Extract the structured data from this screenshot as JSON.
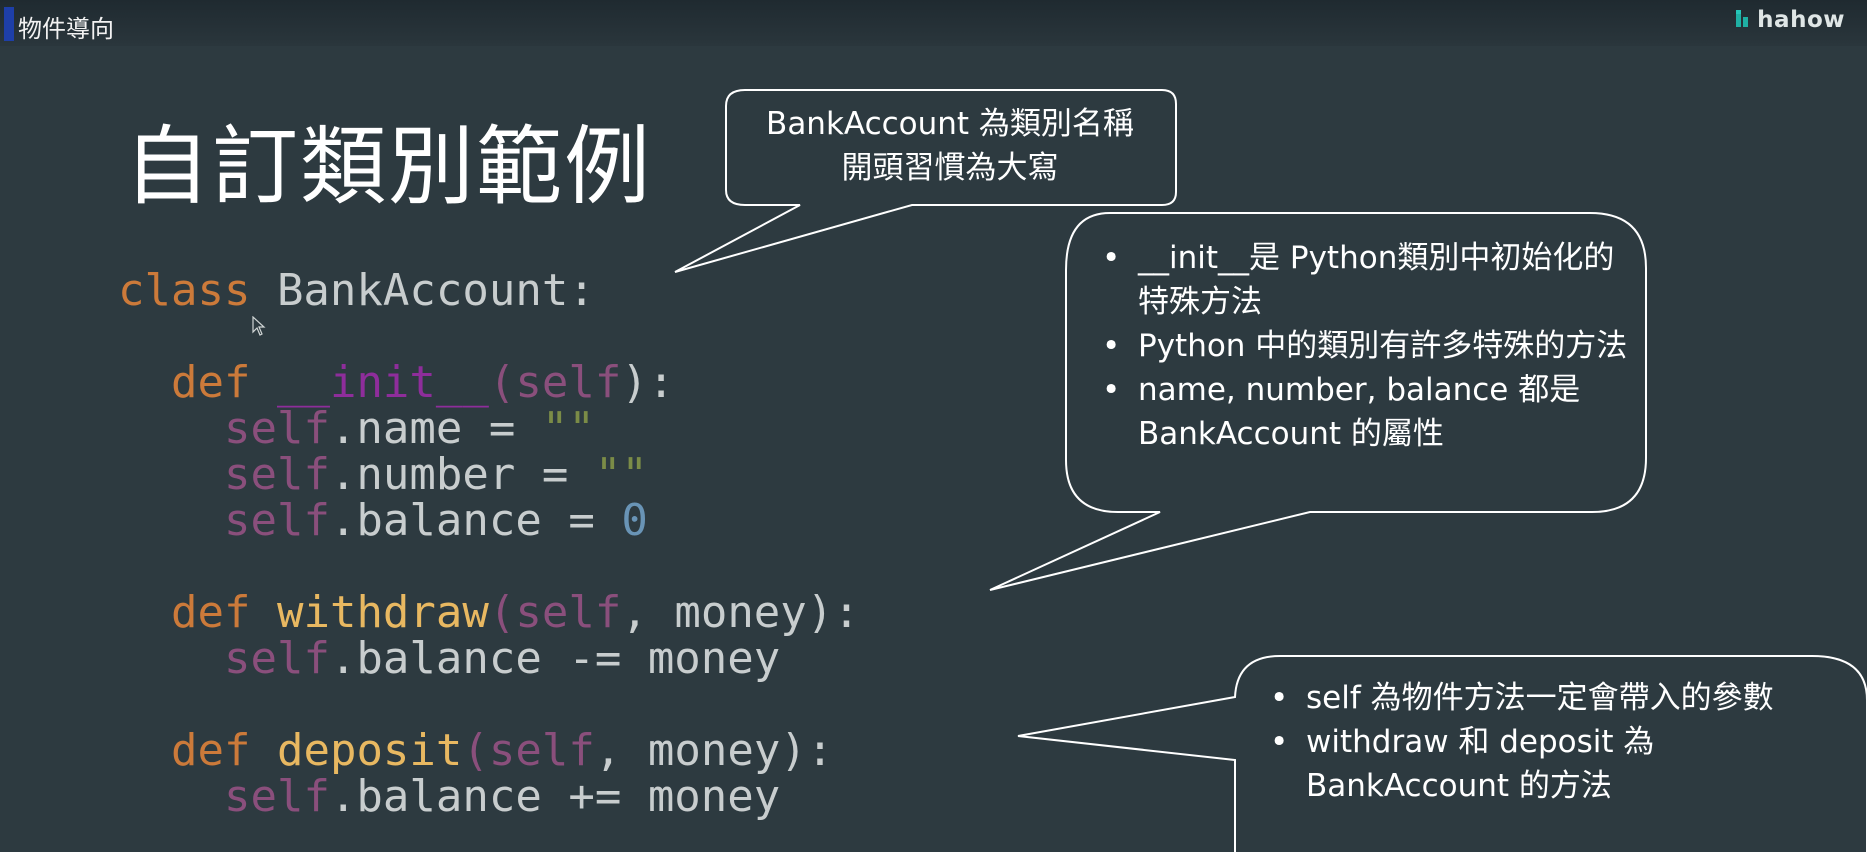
{
  "header": {
    "title": "物件導向",
    "brand": "hahow"
  },
  "slide": {
    "title": "自訂類別範例"
  },
  "code": {
    "class_kw": "class",
    "class_name": " BankAccount:",
    "def_kw": "def",
    "init_name": "__init__",
    "self": "self",
    "init_params_open": "(",
    "init_params_close": "):",
    "name_assign": ".name = ",
    "number_assign": ".number = ",
    "balance_assign": ".balance = ",
    "empty_str": "\"\"",
    "zero": "0",
    "withdraw_name": "withdraw",
    "deposit_name": "deposit",
    "money_params_open": "(",
    "money_params_close": ", money):",
    "withdraw_body": ".balance -= money",
    "deposit_body": ".balance += money"
  },
  "callouts": {
    "class_name_note": [
      "BankAccount 為類別名稱",
      "開頭習慣為大寫"
    ],
    "init_notes": [
      "__init__是 Python類別中初始化的特殊方法",
      "Python 中的類別有許多特殊的方法",
      "name, number, balance 都是 BankAccount 的屬性"
    ],
    "method_notes": [
      "self 為物件方法一定會帶入的參數",
      "withdraw 和 deposit 為 BankAccount 的方法"
    ]
  },
  "colors": {
    "background": "#2d3a40",
    "keyword": "#cc7a3a",
    "function": "#e8b861",
    "dunder": "#8e2d9b",
    "self": "#8a4f7c",
    "string": "#7b8c47",
    "number": "#6994b6",
    "code_text": "#c8cdce"
  },
  "icons": {
    "brand": "hahow-logo-icon",
    "cursor": "mouse-cursor-icon"
  }
}
